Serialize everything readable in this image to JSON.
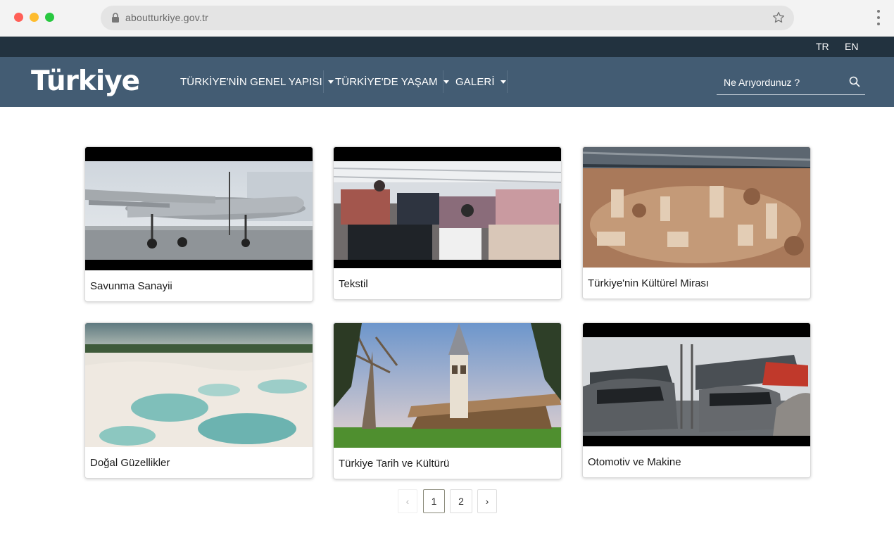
{
  "browser": {
    "url": "aboutturkiye.gov.tr"
  },
  "langbar": {
    "tr": "TR",
    "en": "EN"
  },
  "header": {
    "logo": "Türkiye",
    "nav": [
      {
        "label": "TÜRKİYE'NİN GENEL YAPISI"
      },
      {
        "label": "TÜRKİYE'DE YAŞAM"
      },
      {
        "label": "GALERİ"
      }
    ],
    "search_placeholder": "Ne Arıyordunuz ?"
  },
  "gallery": {
    "cards": [
      {
        "title": "Savunma Sanayii",
        "image": "drone aircraft on runway"
      },
      {
        "title": "Tekstil",
        "image": "textile factory workers"
      },
      {
        "title": "Türkiye'nin Kültürel Mirası",
        "image": "ancient stone ruins excavation"
      },
      {
        "title": "Doğal Güzellikler",
        "image": "white travertine terraces"
      },
      {
        "title": "Türkiye Tarih ve Kültürü",
        "image": "palace tower and pavilion"
      },
      {
        "title": "Otomotiv ve Makine",
        "image": "cars on transport carrier"
      }
    ]
  },
  "pagination": {
    "prev": "‹",
    "pages": [
      "1",
      "2"
    ],
    "current": "1",
    "next": "›"
  },
  "colors": {
    "langbar": "#22323f",
    "navbar": "#435c73"
  }
}
